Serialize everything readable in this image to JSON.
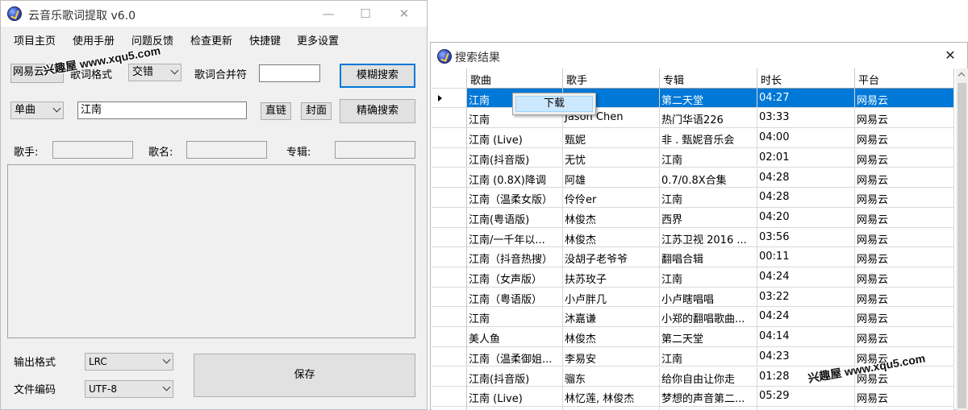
{
  "main_window": {
    "title": "云音乐歌词提取 v6.0",
    "titlebar_buttons": {
      "minimize": "—",
      "maximize": "☐",
      "close": "✕"
    },
    "menu": [
      "项目主页",
      "使用手册",
      "问题反馈",
      "检查更新",
      "快捷键",
      "更多设置"
    ],
    "platform_select": "网易云",
    "lyric_format_label": "歌词格式",
    "lyric_format_select": "交错",
    "lyric_merge_label": "歌词合并符",
    "lyric_merge_value": "",
    "fuzzy_search_button": "模糊搜索",
    "search_type_select": "单曲",
    "search_input_value": "江南",
    "direct_link_button": "直链",
    "cover_button": "封面",
    "exact_search_button": "精确搜索",
    "singer_label": "歌手:",
    "song_name_label": "歌名:",
    "album_label": "专辑:",
    "output_format_label": "输出格式",
    "output_format_select": "LRC",
    "file_encoding_label": "文件编码",
    "file_encoding_select": "UTF-8",
    "save_button": "保存"
  },
  "results_window": {
    "title": "搜索结果",
    "close": "✕",
    "columns": [
      "歌曲",
      "歌手",
      "专辑",
      "时长",
      "平台"
    ],
    "rows": [
      [
        "江南",
        "林俊杰",
        "第二天堂",
        "04:27",
        "网易云"
      ],
      [
        "江南",
        "Jason Chen",
        "热门华语226",
        "03:33",
        "网易云"
      ],
      [
        "江南 (Live)",
        "甄妮",
        "非 . 甄妮音乐会",
        "04:00",
        "网易云"
      ],
      [
        "江南(抖音版)",
        "无忧",
        "江南",
        "02:01",
        "网易云"
      ],
      [
        "江南 (0.8X)降调",
        "阿雄",
        "0.7/0.8X合集",
        "04:28",
        "网易云"
      ],
      [
        "江南（温柔女版）",
        "伶伶er",
        "江南",
        "04:28",
        "网易云"
      ],
      [
        "江南(粤语版)",
        "林俊杰",
        "西界",
        "04:20",
        "网易云"
      ],
      [
        "江南/一千年以...",
        "林俊杰",
        "江苏卫视 2016 ...",
        "03:56",
        "网易云"
      ],
      [
        "江南（抖音热搜）",
        "没胡子老爷爷",
        "翻唱合辑",
        "00:11",
        "网易云"
      ],
      [
        "江南（女声版）",
        "扶苏玫子",
        "江南",
        "04:24",
        "网易云"
      ],
      [
        "江南（粤语版）",
        "小卢胖几",
        "小卢瞎唱唱",
        "03:22",
        "网易云"
      ],
      [
        "江南",
        "沐嘉谦",
        "小郑的翻唱歌曲...",
        "04:24",
        "网易云"
      ],
      [
        "美人鱼",
        "林俊杰",
        "第二天堂",
        "04:14",
        "网易云"
      ],
      [
        "江南（温柔御姐...",
        "李易安",
        "江南",
        "04:23",
        "网易云"
      ],
      [
        "江南(抖音版)",
        "骝东",
        "给你自由让你走",
        "01:28",
        "网易云"
      ],
      [
        "江南 (Live)",
        "林忆莲, 林俊杰",
        "梦想的声音第二...",
        "05:29",
        "网易云"
      ],
      [
        "",
        "",
        "",
        "",
        ""
      ]
    ],
    "context_menu_item": "下载"
  },
  "watermarks": [
    "兴趣屋 www.xqu5.com",
    "兴趣屋 www.xqu5.com"
  ],
  "colors": {
    "selection": "#0078d7",
    "focus_border": "#0078d7",
    "menu_hover": "#cce8ff"
  }
}
